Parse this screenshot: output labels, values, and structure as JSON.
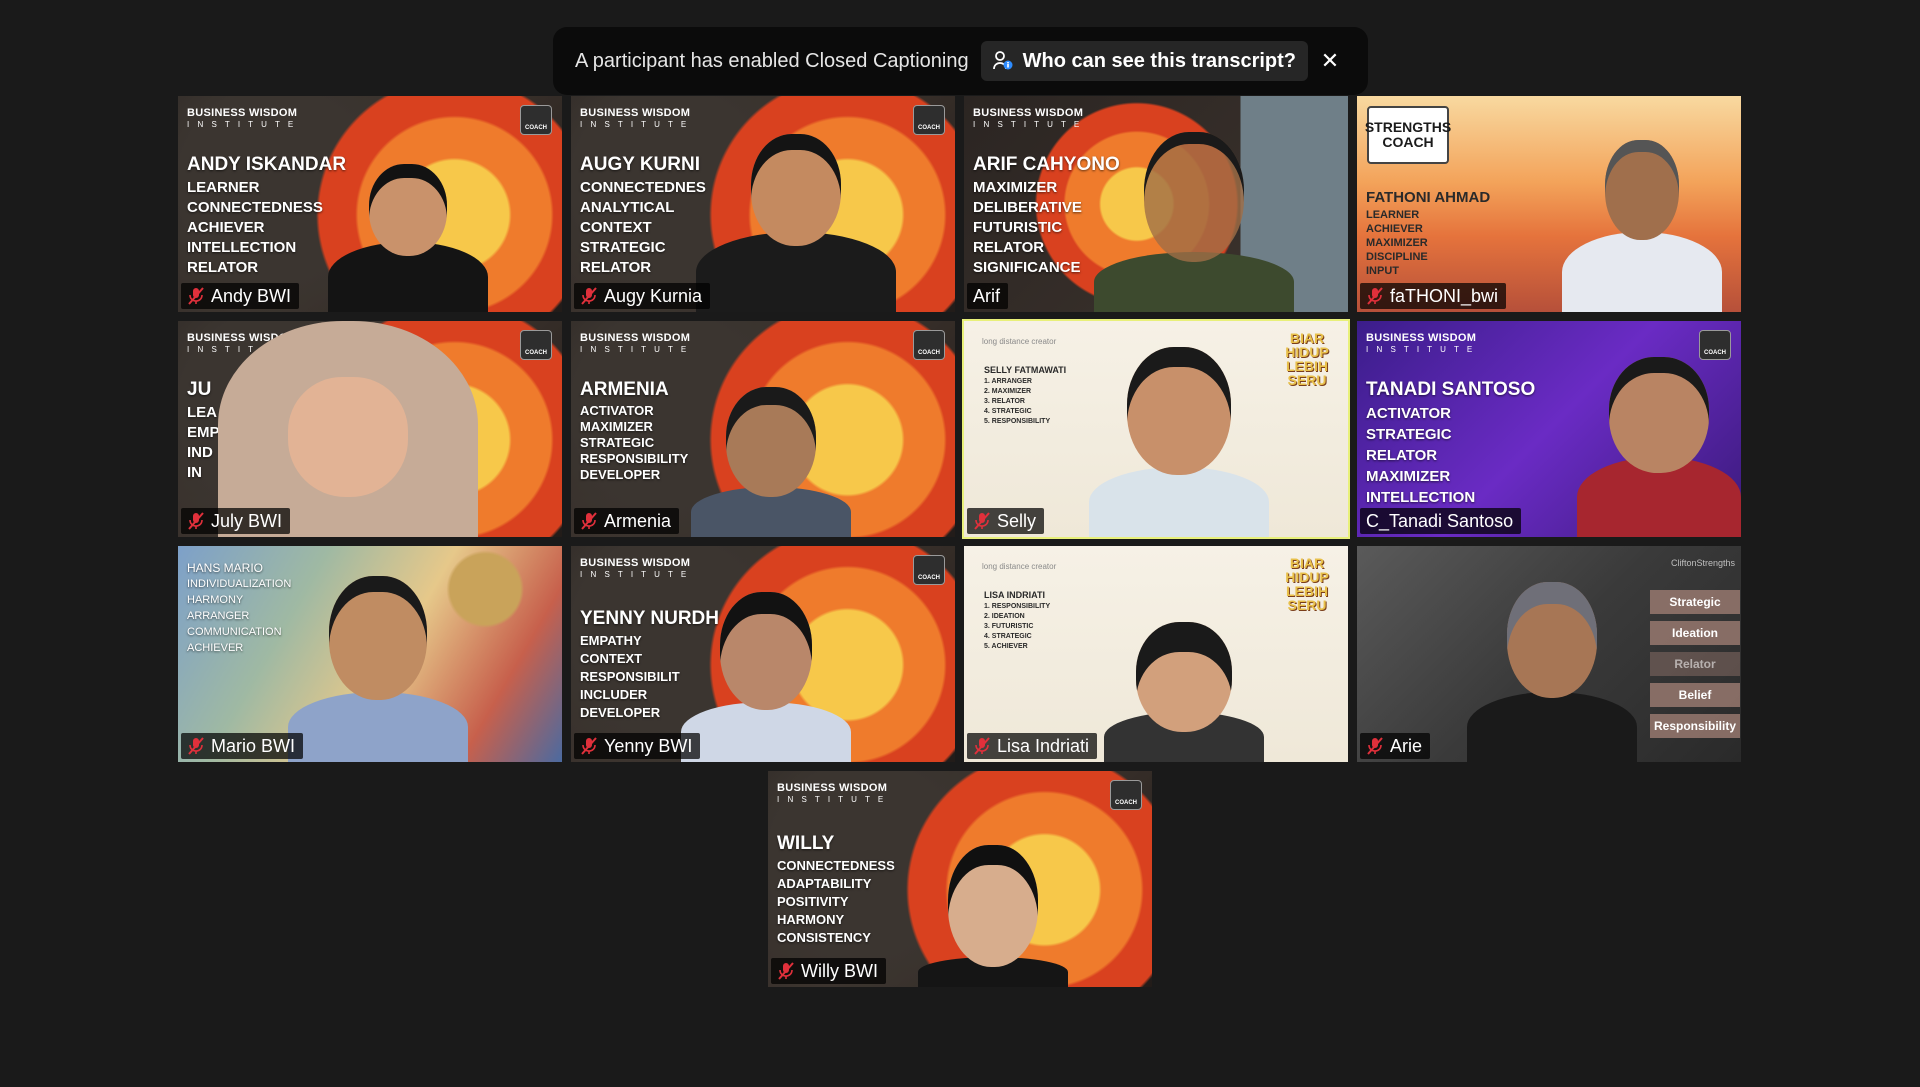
{
  "banner": {
    "message": "A participant has enabled Closed Captioning",
    "transcript_button": "Who can see this transcript?",
    "close_glyph": "✕"
  },
  "colors": {
    "background": "#1a1a1a",
    "active_speaker_border": "#e8f07a",
    "muted_icon": "#e0303b"
  },
  "brand": {
    "line1": "BUSINESS WISDOM",
    "line2": "I N S T I T U T E",
    "badge": "COACH"
  },
  "tiles": [
    {
      "name": "Andy BWI",
      "muted": true,
      "overlay_name": "ANDY ISKANDAR",
      "strengths": [
        "LEARNER",
        "CONNECTEDNESS",
        "ACHIEVER",
        "INTELLECTION",
        "RELATOR"
      ]
    },
    {
      "name": "Augy Kurnia",
      "muted": true,
      "overlay_name": "AUGY KURNI",
      "strengths": [
        "CONNECTEDNES",
        "ANALYTICAL",
        "CONTEXT",
        "STRATEGIC",
        "RELATOR"
      ]
    },
    {
      "name": "Arif",
      "muted": false,
      "overlay_name": "ARIF CAHYONO",
      "strengths": [
        "MAXIMIZER",
        "DELIBERATIVE",
        "FUTURISTIC",
        "RELATOR",
        "SIGNIFICANCE"
      ]
    },
    {
      "name": "faTHONI_bwi",
      "muted": true,
      "overlay_title": "STRENGTHS COACH",
      "overlay_name": "FATHONI AHMAD",
      "strengths": [
        "LEARNER",
        "ACHIEVER",
        "MAXIMIZER",
        "DISCIPLINE",
        "INPUT"
      ]
    },
    {
      "name": "July BWI",
      "muted": true,
      "overlay_name": "JU",
      "strengths": [
        "LEA",
        "EMP",
        "IND",
        "IN"
      ]
    },
    {
      "name": "Armenia",
      "muted": true,
      "overlay_name": "ARMENIA",
      "strengths": [
        "ACTIVATOR",
        "MAXIMIZER",
        "STRATEGIC",
        "RESPONSIBILITY",
        "DEVELOPER"
      ]
    },
    {
      "name": "Selly",
      "muted": true,
      "active": true,
      "overlay_name": "SELLY FATMAWATI",
      "strengths": [
        "1. ARRANGER",
        "2. MAXIMIZER",
        "3. RELATOR",
        "4. STRATEGIC",
        "5. RESPONSIBILITY"
      ],
      "ldc": "long distance creator",
      "biar": "BIAR HIDUP LEBIH SERU"
    },
    {
      "name": "C_Tanadi Santoso",
      "muted": false,
      "overlay_name": "TANADI SANTOSO",
      "strengths": [
        "ACTIVATOR",
        "STRATEGIC",
        "RELATOR",
        "MAXIMIZER",
        "INTELLECTION"
      ]
    },
    {
      "name": "Mario BWI",
      "muted": true,
      "overlay_name": "HANS MARIO",
      "strengths": [
        "INDIVIDUALIZATION",
        "HARMONY",
        "ARRANGER",
        "COMMUNICATION",
        "ACHIEVER"
      ]
    },
    {
      "name": "Yenny BWI",
      "muted": true,
      "overlay_name": "YENNY NURDH",
      "strengths": [
        "EMPATHY",
        "CONTEXT",
        "RESPONSIBILIT",
        "INCLUDER",
        "DEVELOPER"
      ]
    },
    {
      "name": "Lisa Indriati",
      "muted": true,
      "overlay_name": "LISA INDRIATI",
      "strengths": [
        "1. RESPONSIBILITY",
        "2. IDEATION",
        "3. FUTURISTIC",
        "4. STRATEGIC",
        "5. ACHIEVER"
      ],
      "ldc": "long distance creator",
      "biar": "BIAR HIDUP LEBIH SERU"
    },
    {
      "name": "Arie",
      "muted": true,
      "gym_logo": "CliftonStrengths",
      "strengths": [
        "Strategic",
        "Ideation",
        "Relator",
        "Belief",
        "Responsibility"
      ]
    },
    {
      "name": "Willy BWI",
      "muted": true,
      "overlay_name": "WILLY",
      "strengths": [
        "CONNECTEDNESS",
        "ADAPTABILITY",
        "POSITIVITY",
        "HARMONY",
        "CONSISTENCY"
      ]
    }
  ]
}
